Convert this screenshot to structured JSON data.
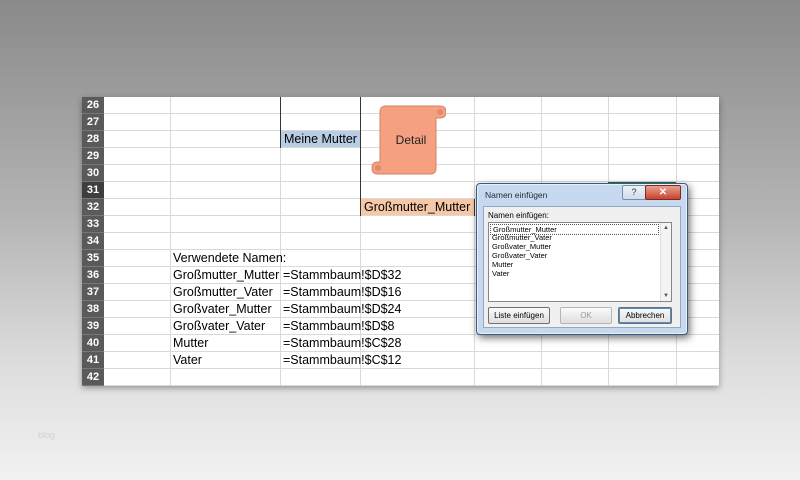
{
  "sheet": {
    "rows": [
      "26",
      "27",
      "28",
      "29",
      "30",
      "31",
      "32",
      "33",
      "34",
      "35",
      "36",
      "37",
      "38",
      "39",
      "40",
      "41",
      "42"
    ],
    "active_row": "31",
    "cells": {
      "meine_mutter": "Meine Mutter",
      "grossmutter_mutter_node": "Großmutter_Mutter",
      "verwendete_namen": "Verwendete Namen:"
    },
    "names_table": [
      {
        "name": "Großmutter_Mutter",
        "ref": "=Stammbaum!$D$32"
      },
      {
        "name": "Großmutter_Vater",
        "ref": "=Stammbaum!$D$16"
      },
      {
        "name": "Großvater_Mutter",
        "ref": "=Stammbaum!$D$24"
      },
      {
        "name": "Großvater_Vater",
        "ref": "=Stammbaum!$D$8"
      },
      {
        "name": "Mutter",
        "ref": "=Stammbaum!$C$28"
      },
      {
        "name": "Vater",
        "ref": "=Stammbaum!$C$12"
      }
    ],
    "shape_label": "Detail",
    "shape_color": "#f4a081"
  },
  "dialog": {
    "title": "Namen einfügen",
    "help": "?",
    "close": "✕",
    "label": "Namen einfügen:",
    "items": [
      "Großmutter_Mutter",
      "Großmutter_Vater",
      "Großvater_Mutter",
      "Großvater_Vater",
      "Mutter",
      "Vater"
    ],
    "selected_index": 0,
    "buttons": {
      "paste_list": "Liste einfügen",
      "ok": "OK",
      "cancel": "Abbrechen"
    }
  },
  "watermark": "blog"
}
